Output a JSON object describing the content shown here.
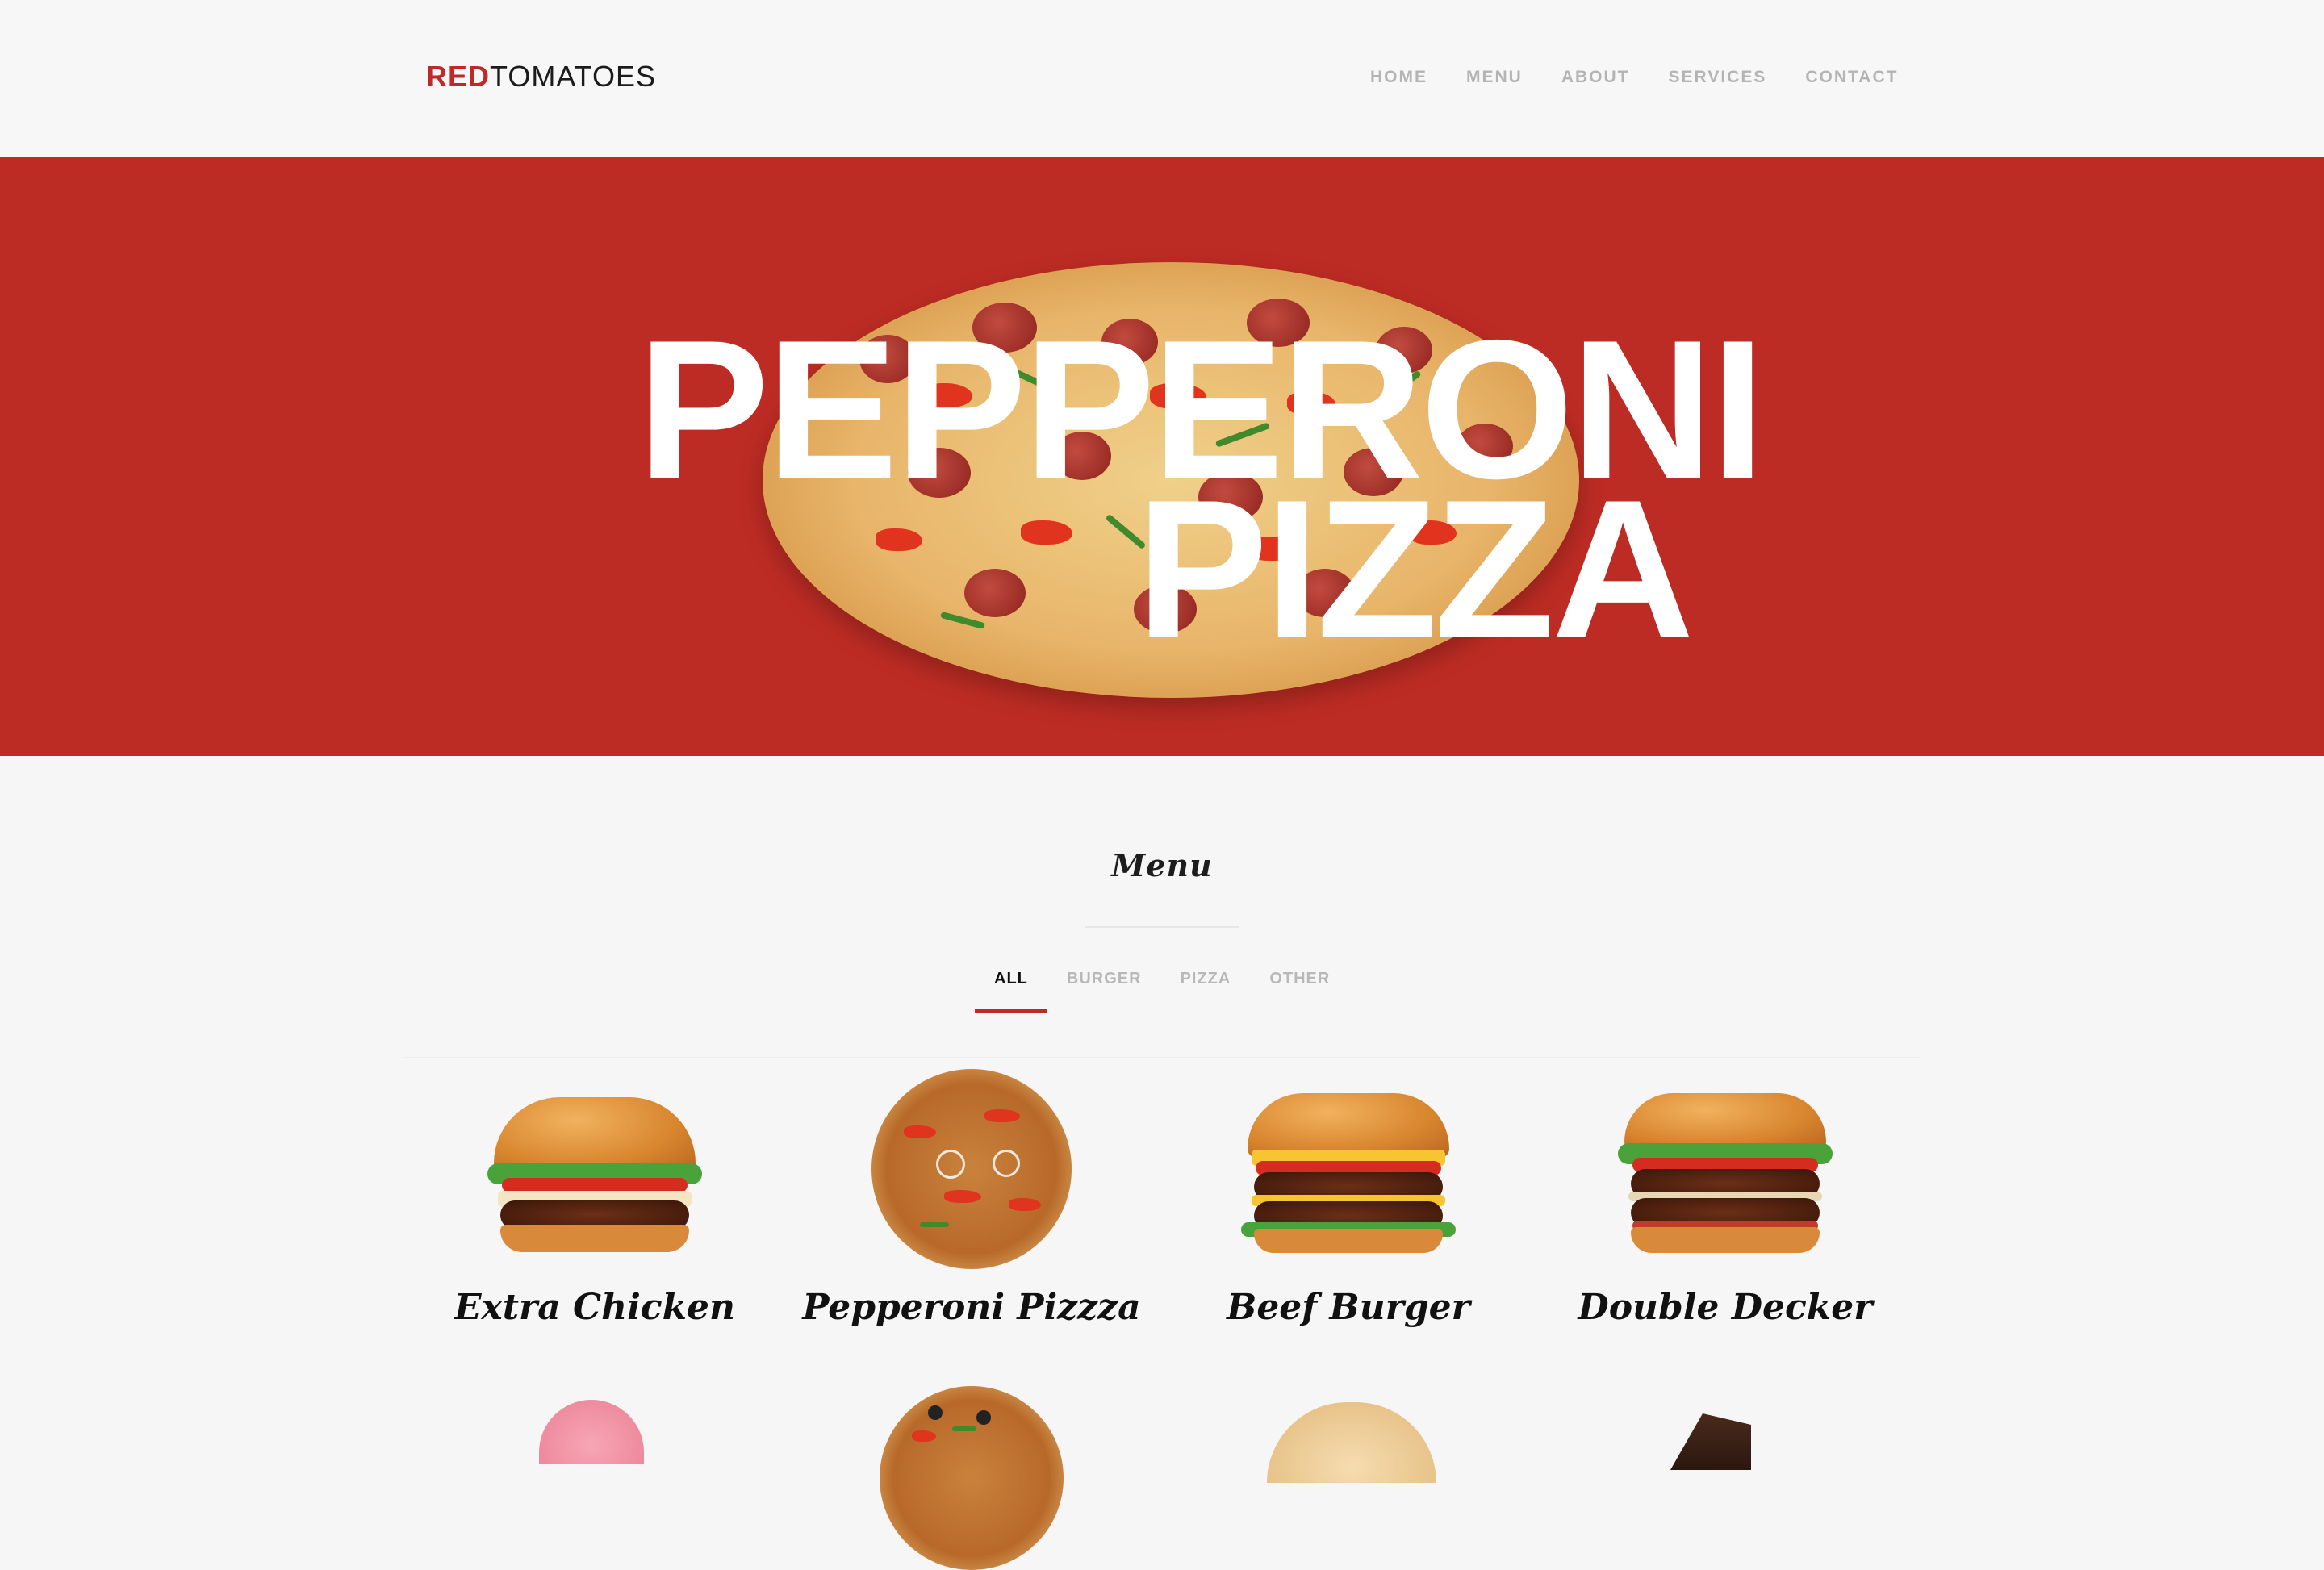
{
  "header": {
    "logo_red": "RED",
    "logo_rest": "TOMATOES",
    "nav": [
      "HOME",
      "MENU",
      "ABOUT",
      "SERVICES",
      "CONTACT"
    ]
  },
  "hero": {
    "line1": "PEPPERONI",
    "line2": "PIZZA",
    "background": "#bd2c24"
  },
  "menu": {
    "title": "Menu",
    "filters": [
      "ALL",
      "BURGER",
      "PIZZA",
      "OTHER"
    ],
    "active_filter": "ALL",
    "items": [
      {
        "name": "Extra Chicken",
        "icon": "burger-image"
      },
      {
        "name": "Pepperoni Pizzza",
        "icon": "pizza-image"
      },
      {
        "name": "Beef Burger",
        "icon": "burger-image"
      },
      {
        "name": "Double Decker",
        "icon": "burger-image"
      }
    ],
    "second_row_icons": [
      "cupcake-image",
      "pizza-image",
      "bun-image",
      "cake-image"
    ]
  },
  "colors": {
    "accent": "#bd2c24",
    "nav_text": "#b4b4b4",
    "page_background": "#f6f6f6"
  }
}
